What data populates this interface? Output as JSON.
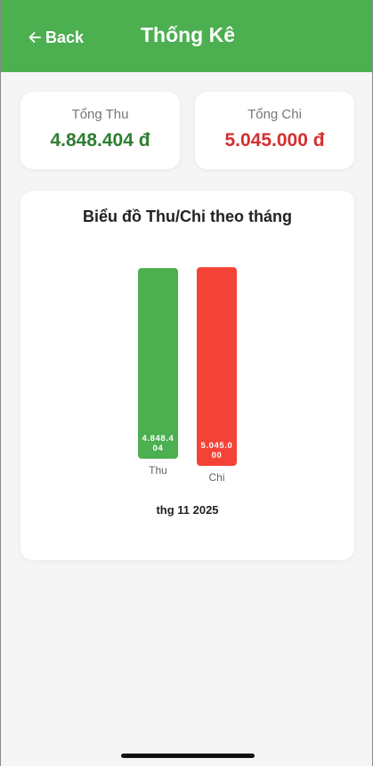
{
  "header": {
    "back_label": "Back",
    "title": "Thống Kê",
    "color": "#4caf50"
  },
  "summary": {
    "income": {
      "label": "Tổng Thu",
      "amount": "4.848.404 đ",
      "color": "#2e7d32"
    },
    "expense": {
      "label": "Tổng Chi",
      "amount": "5.045.000 đ",
      "color": "#d32f2f"
    }
  },
  "chart": {
    "title": "Biểu đồ Thu/Chi theo tháng",
    "month": "thg 11 2025"
  },
  "chart_data": {
    "type": "bar",
    "title": "Biểu đồ Thu/Chi theo tháng",
    "categories": [
      "Thu",
      "Chi"
    ],
    "values": [
      4848404,
      5045000
    ],
    "value_labels": [
      "4.848.404",
      "5.045.000"
    ],
    "colors": [
      "#4caf50",
      "#f44336"
    ],
    "xlabel": "thg 11 2025",
    "ylabel": "",
    "ylim": [
      0,
      5045000
    ],
    "grid": false
  }
}
